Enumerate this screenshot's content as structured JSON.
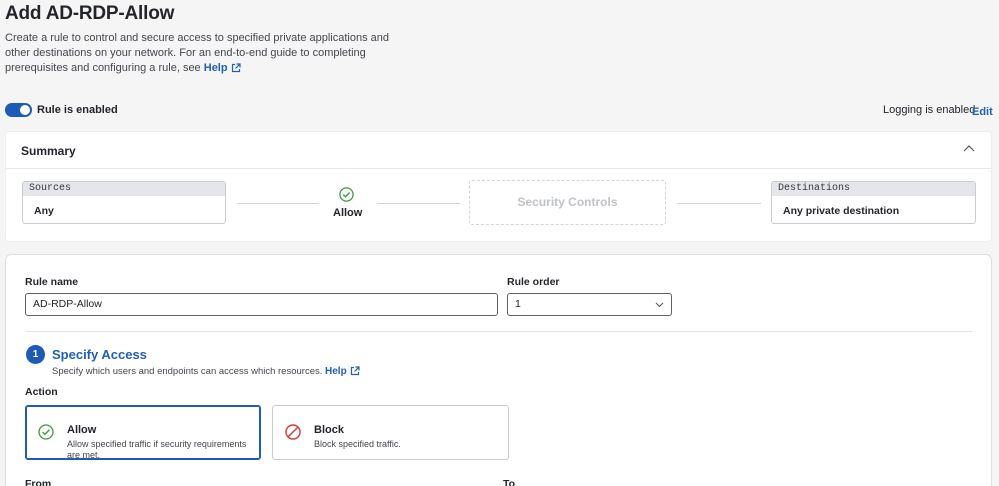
{
  "header": {
    "title": "Add AD-RDP-Allow",
    "description": "Create a rule to control and secure access to specified private applications and other destinations on your network. For an end-to-end guide to completing prerequisites and configuring a rule, see",
    "help_label": "Help"
  },
  "status_bar": {
    "rule_enabled_label": "Rule is enabled",
    "rule_enabled": true,
    "logging_label": "Logging is enabled",
    "edit_label": "Edit"
  },
  "summary": {
    "title": "Summary",
    "sources": {
      "label": "Sources",
      "value": "Any"
    },
    "action": "Allow",
    "security_controls": "Security Controls",
    "destinations": {
      "label": "Destinations",
      "value": "Any private destination"
    }
  },
  "form": {
    "rule_name_label": "Rule name",
    "rule_name_value": "AD-RDP-Allow",
    "rule_order_label": "Rule order",
    "rule_order_value": "1",
    "step": {
      "number": "1",
      "title": "Specify Access",
      "description": "Specify which users and endpoints can access which resources.",
      "help_label": "Help"
    },
    "action_label": "Action",
    "actions": [
      {
        "title": "Allow",
        "description": "Allow specified traffic if security requirements are met.",
        "selected": true
      },
      {
        "title": "Block",
        "description": "Block specified traffic.",
        "selected": false
      }
    ],
    "from_label": "From",
    "to_label": "To"
  },
  "colors": {
    "accent": "#1e5bb4",
    "link": "#1f5fb5",
    "success": "#3c9a3c",
    "danger": "#d33a3a"
  },
  "icons": [
    "external-link-icon",
    "chevron-up-icon",
    "check-circle-icon",
    "chevron-down-icon",
    "block-icon"
  ]
}
